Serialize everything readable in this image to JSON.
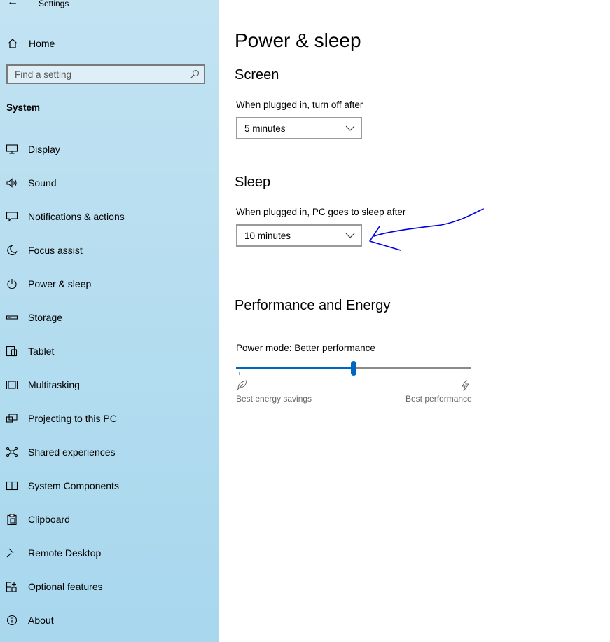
{
  "window": {
    "title": "Settings"
  },
  "sidebar": {
    "home_label": "Home",
    "search_placeholder": "Find a setting",
    "section_title": "System",
    "items": [
      {
        "label": "Display",
        "icon": "monitor-icon"
      },
      {
        "label": "Sound",
        "icon": "speaker-icon"
      },
      {
        "label": "Notifications & actions",
        "icon": "notification-icon"
      },
      {
        "label": "Focus assist",
        "icon": "moon-icon"
      },
      {
        "label": "Power & sleep",
        "icon": "power-icon"
      },
      {
        "label": "Storage",
        "icon": "storage-icon"
      },
      {
        "label": "Tablet",
        "icon": "tablet-icon"
      },
      {
        "label": "Multitasking",
        "icon": "multitasking-icon"
      },
      {
        "label": "Projecting to this PC",
        "icon": "projecting-icon"
      },
      {
        "label": "Shared experiences",
        "icon": "shared-experiences-icon"
      },
      {
        "label": "System Components",
        "icon": "system-components-icon"
      },
      {
        "label": "Clipboard",
        "icon": "clipboard-icon"
      },
      {
        "label": "Remote Desktop",
        "icon": "remote-desktop-icon"
      },
      {
        "label": "Optional features",
        "icon": "optional-features-icon"
      },
      {
        "label": "About",
        "icon": "info-icon"
      }
    ]
  },
  "main": {
    "page_title": "Power & sleep",
    "screen": {
      "heading": "Screen",
      "label": "When plugged in, turn off after",
      "value": "5 minutes"
    },
    "sleep": {
      "heading": "Sleep",
      "label": "When plugged in, PC goes to sleep after",
      "value": "10 minutes"
    },
    "performance": {
      "heading": "Performance and Energy",
      "power_mode_label": "Power mode: Better performance",
      "slider_position": 0.5,
      "min_label": "Best energy savings",
      "max_label": "Best performance"
    }
  },
  "colors": {
    "sidebar_bg": "#b3dcef",
    "accent": "#0067c0",
    "annotation": "#0000e0"
  }
}
